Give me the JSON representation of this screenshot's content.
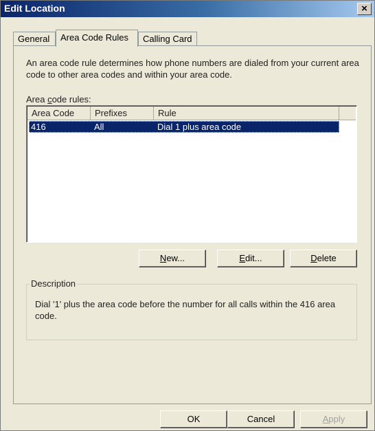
{
  "window": {
    "title": "Edit Location",
    "close_label": "×"
  },
  "tabs": [
    {
      "label": "General",
      "active": false
    },
    {
      "label": "Area Code Rules",
      "active": true
    },
    {
      "label": "Calling Card",
      "active": false
    }
  ],
  "rules_tab": {
    "intro": "An area code rule determines how phone numbers are dialed from your current area code to other area codes and within your area code.",
    "list_label_prefix": "Area ",
    "list_label_accel": "c",
    "list_label_suffix": "ode rules:",
    "columns": [
      "Area Code",
      "Prefixes",
      "Rule"
    ],
    "rows": [
      {
        "area_code": "416",
        "prefixes": "All",
        "rule": "Dial 1 plus area code",
        "selected": true
      }
    ],
    "buttons": {
      "new_accel": "N",
      "new_rest": "ew...",
      "edit_accel": "E",
      "edit_rest": "dit...",
      "delete_accel": "D",
      "delete_rest": "elete"
    },
    "description_title": "Description",
    "description_text": "Dial '1' plus the area code before the number for all calls within the 416 area code."
  },
  "footer": {
    "ok": "OK",
    "cancel": "Cancel",
    "apply_accel": "A",
    "apply_rest": "pply",
    "apply_enabled": false
  },
  "colors": {
    "selection": "#0a246a",
    "dialog_bg": "#ece9d8"
  }
}
